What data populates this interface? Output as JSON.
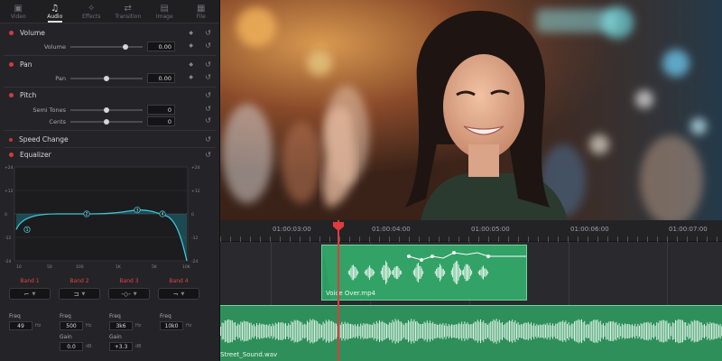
{
  "inspector": {
    "tabs": [
      {
        "label": "Video",
        "icon": "video-icon",
        "glyph": "▣"
      },
      {
        "label": "Audio",
        "icon": "music-note-icon",
        "glyph": "♫"
      },
      {
        "label": "Effects",
        "icon": "magic-wand-icon",
        "glyph": "✧"
      },
      {
        "label": "Transition",
        "icon": "transition-icon",
        "glyph": "⇄"
      },
      {
        "label": "Image",
        "icon": "image-icon",
        "glyph": "▤"
      },
      {
        "label": "File",
        "icon": "file-icon",
        "glyph": "▦"
      }
    ],
    "active_tab": "Audio",
    "volume": {
      "title": "Volume",
      "param": "Volume",
      "value": "0.00",
      "level": 0.76
    },
    "pan": {
      "title": "Pan",
      "param": "Pan",
      "value": "0.00",
      "level": 0.5
    },
    "pitch": {
      "title": "Pitch",
      "semitones_label": "Semi Tones",
      "semitones_value": "0",
      "semitones_level": 0.5,
      "cents_label": "Cents",
      "cents_value": "0",
      "cents_level": 0.5
    },
    "speed_change": {
      "title": "Speed Change"
    },
    "equalizer": {
      "title": "Equalizer",
      "y_ticks_left": [
        "+24",
        "+12",
        "0",
        "-12",
        "-24"
      ],
      "y_ticks_right": [
        "+24",
        "+12",
        "0",
        "-12",
        "-24"
      ],
      "x_ticks": [
        "10",
        "50",
        "100",
        "1K",
        "5K",
        "10K"
      ],
      "nodes": [
        {
          "label": "1",
          "gain": -8
        },
        {
          "label": "2",
          "gain": 0
        },
        {
          "label": "3",
          "gain": 2
        },
        {
          "label": "4",
          "gain": 0
        }
      ]
    },
    "bands": [
      {
        "name": "Band 1",
        "shape": "⌐",
        "freq_label": "Freq",
        "freq_value": "49",
        "gain_label": "",
        "gain_value": ""
      },
      {
        "name": "Band 2",
        "shape": "⊐",
        "freq_label": "Freq",
        "freq_value": "500",
        "gain_label": "Gain",
        "gain_value": "0.0",
        "unit": "dB"
      },
      {
        "name": "Band 3",
        "shape": "-◇-",
        "freq_label": "Freq",
        "freq_value": "3k6",
        "gain_label": "Gain",
        "gain_value": "+3.3",
        "unit": "dB"
      },
      {
        "name": "Band 4",
        "shape": "¬",
        "freq_label": "Freq",
        "freq_value": "10k0",
        "gain_label": "",
        "gain_value": ""
      }
    ],
    "hz_unit": "Hz"
  },
  "viewer": {
    "description_color": "#c07040"
  },
  "timeline": {
    "timecodes": [
      "01:00:03:00",
      "01:00:04:00",
      "01:00:05:00",
      "01:00:06:00",
      "01:00:07:00"
    ],
    "clip_voice": "Voice Over.mp4",
    "clip_street": "Street_Sound.wav",
    "playhead_color": "#e23b3b",
    "clip_color": "#2e9b62"
  }
}
